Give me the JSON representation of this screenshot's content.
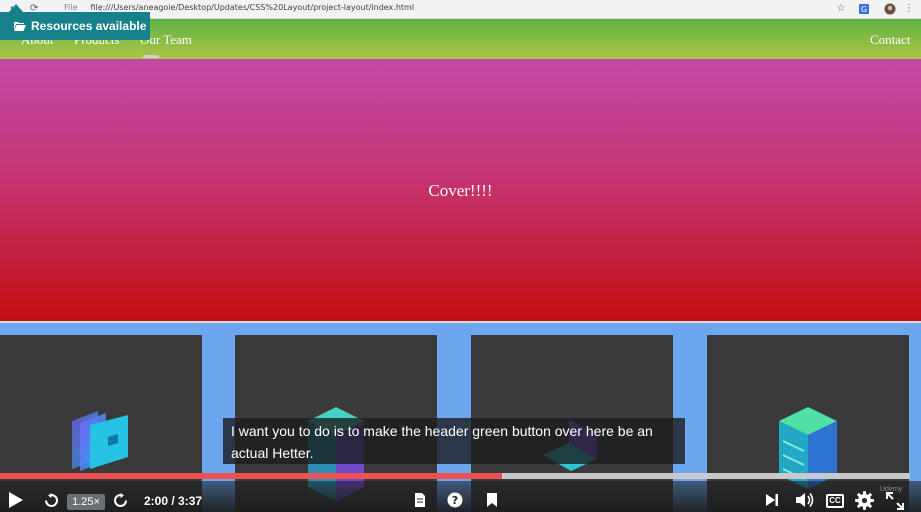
{
  "browser": {
    "url_scheme": "File",
    "url_path": "file:///Users/aneagoie/Desktop/Updates/CSS%20Layout/project-layout/index.html",
    "icons": [
      "back-icon",
      "reload-icon",
      "info-icon",
      "bookmark-star-icon",
      "extension-icon",
      "profile-icon",
      "menu-icon"
    ]
  },
  "site": {
    "nav": [
      "About",
      "Products",
      "Our Team"
    ],
    "contact": "Contact",
    "cover": "Cover!!!!",
    "colors": {
      "header_top": "#5fb245",
      "header_bottom": "#aec544",
      "cover_top": "#c24aa7",
      "cover_bottom": "#c30e12",
      "card_band": "#6ba6ee",
      "card": "#3a3a3a"
    },
    "cards": [
      {
        "icon": "folders-icon"
      },
      {
        "icon": "server-cube-icon"
      },
      {
        "icon": "laptop-icon"
      },
      {
        "icon": "server-stack-icon"
      }
    ]
  },
  "overlay": {
    "resources_label": "Resources available",
    "caption": "I want you to do is to make the header green button over here be an actual Hetter."
  },
  "player": {
    "progress": 0.552,
    "buffered": 1.0,
    "speed": "1.25×",
    "time": "2:00 / 3:37",
    "cc_label": "CC",
    "watermark": "Udemy",
    "accent": "#ec5252",
    "icons": [
      "play-icon",
      "rewind-icon",
      "forward-icon",
      "transcript-icon",
      "help-icon",
      "bookmark-icon",
      "next-icon",
      "volume-icon",
      "settings-icon",
      "fullscreen-icon"
    ]
  }
}
